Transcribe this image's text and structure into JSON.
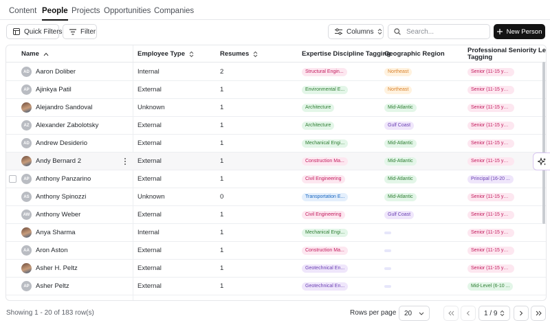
{
  "nav": {
    "tabs": [
      {
        "label": "Content",
        "active": false
      },
      {
        "label": "People",
        "active": true
      },
      {
        "label": "Projects",
        "active": false
      },
      {
        "label": "Opportunities",
        "active": false
      },
      {
        "label": "Companies",
        "active": false
      }
    ]
  },
  "toolbar": {
    "quick_filters_label": "Quick Filters",
    "filter_label": "Filter",
    "columns_label": "Columns",
    "search_placeholder": "Search...",
    "new_person_label": "New Person"
  },
  "table": {
    "columns": {
      "name": "Name",
      "employee_type": "Employee Type",
      "resumes": "Resumes",
      "expertise": "Expertise Discipline Tagging",
      "region": "Geographic Region",
      "seniority_line1": "Professional Seniority Level",
      "seniority_line2": "Tagging"
    },
    "rows": [
      {
        "initials": "AD",
        "photo": false,
        "name": "Aaron Doliber",
        "type": "Internal",
        "resumes": "2",
        "expertise": "Structural Engin...",
        "region": "Northeast",
        "seniority": "Senior (11-15 yea..."
      },
      {
        "initials": "AP",
        "photo": false,
        "name": "Ajinkya Patil",
        "type": "External",
        "resumes": "1",
        "expertise": "Environmental E...",
        "region": "Northeast",
        "seniority": "Senior (11-15 yea..."
      },
      {
        "initials": "",
        "photo": true,
        "name": "Alejandro Sandoval",
        "type": "Unknown",
        "resumes": "1",
        "expertise": "Architecture",
        "region": "Mid-Atlantic",
        "seniority": "Senior (11-15 yea..."
      },
      {
        "initials": "AZ",
        "photo": false,
        "name": "Alexander Zabolotsky",
        "type": "External",
        "resumes": "1",
        "expertise": "Architecture",
        "region": "Gulf Coast",
        "seniority": "Senior (11-15 yea..."
      },
      {
        "initials": "AD",
        "photo": false,
        "name": "Andrew Desiderio",
        "type": "External",
        "resumes": "1",
        "expertise": "Mechanical Engi...",
        "region": "Mid-Atlantic",
        "seniority": "Senior (11-15 yea..."
      },
      {
        "initials": "",
        "photo": true,
        "name": "Andy Bernard 2",
        "type": "External",
        "resumes": "1",
        "expertise": "Construction Ma...",
        "region": "Mid-Atlantic",
        "seniority": "Senior (11-15 yea..."
      },
      {
        "initials": "AP",
        "photo": false,
        "name": "Anthony Panzarino",
        "type": "External",
        "resumes": "1",
        "expertise": "Civil Engineering",
        "region": "Mid-Atlantic",
        "seniority": "Principal (16-20 ..."
      },
      {
        "initials": "AS",
        "photo": false,
        "name": "Anthony Spinozzi",
        "type": "Unknown",
        "resumes": "0",
        "expertise": "Transportation E...",
        "region": "Mid-Atlantic",
        "seniority": "Senior (11-15 yea..."
      },
      {
        "initials": "AW",
        "photo": false,
        "name": "Anthony Weber",
        "type": "External",
        "resumes": "1",
        "expertise": "Civil Engineering",
        "region": "Gulf Coast",
        "seniority": "Senior (11-15 yea..."
      },
      {
        "initials": "",
        "photo": true,
        "name": "Anya Sharma",
        "type": "Internal",
        "resumes": "1",
        "expertise": "Mechanical Engi...",
        "region": "",
        "seniority": "Senior (11-15 yea..."
      },
      {
        "initials": "AA",
        "photo": false,
        "name": "Aron Aston",
        "type": "External",
        "resumes": "1",
        "expertise": "Construction Ma...",
        "region": "",
        "seniority": "Senior (11-15 yea..."
      },
      {
        "initials": "",
        "photo": true,
        "name": "Asher H. Peltz",
        "type": "External",
        "resumes": "1",
        "expertise": "Geotechnical En...",
        "region": "",
        "seniority": "Senior (11-15 yea..."
      },
      {
        "initials": "AP",
        "photo": false,
        "name": "Asher Peltz",
        "type": "External",
        "resumes": "1",
        "expertise": "Geotechnical En...",
        "region": "",
        "seniority": "Mid-Level (6-10 ..."
      }
    ]
  },
  "footer": {
    "showing": "Showing 1 - 20 of 183 row(s)",
    "rows_per_page_label": "Rows per page",
    "rows_per_page_value": "20",
    "page_value": "1 / 9"
  },
  "colors": {
    "accent": "#141414",
    "expertise": {
      "Structural Engin...": [
        "#fde7f0",
        "#c2185b"
      ],
      "Environmental E...": [
        "#e3f6e8",
        "#2e7d32"
      ],
      "Architecture": [
        "#e3f6e8",
        "#2e7d32"
      ],
      "Mechanical Engi...": [
        "#e3f6e8",
        "#2e7d32"
      ],
      "Construction Ma...": [
        "#fde7f0",
        "#c2185b"
      ],
      "Civil Engineering": [
        "#fde7f0",
        "#c2185b"
      ],
      "Transportation E...": [
        "#e4effc",
        "#1565c0"
      ],
      "Geotechnical En...": [
        "#efe6fb",
        "#6a3fb3"
      ]
    },
    "region": {
      "Northeast": [
        "#fff2df",
        "#d9822b"
      ],
      "Mid-Atlantic": [
        "#e3f6e8",
        "#2e7d32"
      ],
      "Gulf Coast": [
        "#efe6fb",
        "#6a3fb3"
      ],
      "": [
        "#e6e6fa",
        "#e6e6fa"
      ]
    },
    "seniority": {
      "Senior (11-15 yea...": [
        "#fde7f0",
        "#c2185b"
      ],
      "Principal (16-20 ...": [
        "#efe6fb",
        "#6a3fb3"
      ],
      "Mid-Level (6-10 ...": [
        "#e3f6e8",
        "#2e7d32"
      ]
    }
  },
  "icons": {
    "quick_filters": "table-icon",
    "filter": "filter-lines-icon",
    "columns": "sliders-icon",
    "search": "search-icon",
    "new_person": "plus-icon",
    "sort": "sort-arrows-icon",
    "row_menu": "kebab-icon",
    "assistant": "sparkle-icon"
  }
}
